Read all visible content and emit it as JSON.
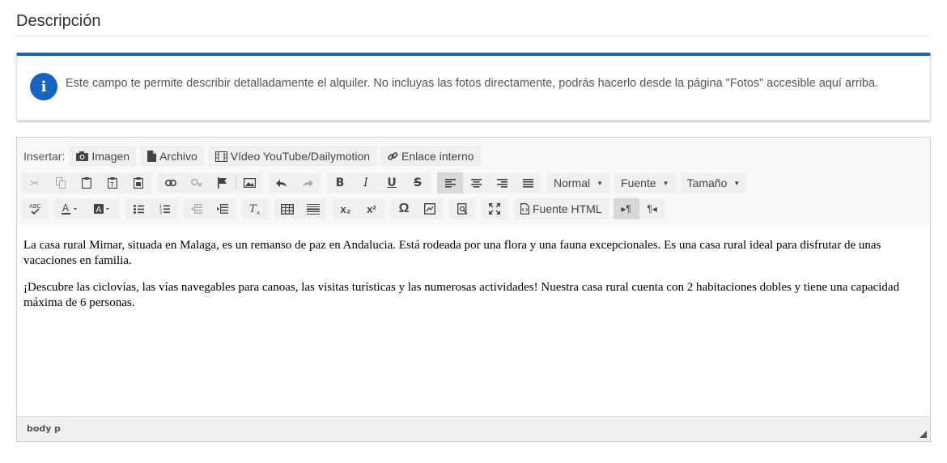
{
  "section": {
    "title": "Descripción"
  },
  "info": {
    "icon": "info-icon",
    "text": "Este campo te permite describir detalladamente el alquiler. No incluyas las fotos directamente, podrás hacerlo desde la página \"Fotos\" accesible aquí arriba.",
    "accent": "#1565c0"
  },
  "toolbar": {
    "insert_label": "Insertar:",
    "insert_buttons": [
      {
        "label": "Imagen",
        "icon": "camera-icon"
      },
      {
        "label": "Archivo",
        "icon": "file-icon"
      },
      {
        "label": "Vídeo YouTube/Dailymotion",
        "icon": "film-icon"
      },
      {
        "label": "Enlace interno",
        "icon": "link-icon"
      }
    ],
    "format_label": "Normal",
    "font_label": "Fuente",
    "size_label": "Tamaño",
    "source_label": "Fuente HTML",
    "bold": "B",
    "italic": "I",
    "underline": "U",
    "strike": "S",
    "subscript": "x₂",
    "superscript": "x²",
    "omega": "Ω",
    "ltr": "▸¶",
    "rtl": "¶◂"
  },
  "content": {
    "paragraphs": [
      "La casa rural Mimar, situada en Malaga, es un remanso de paz en Andalucia. Está rodeada por una flora y una fauna excepcionales. Es una casa rural ideal para disfrutar de unas vacaciones en familia.",
      "¡Descubre las ciclovías, las vías navegables para canoas, las visitas turísticas y las numerosas actividades! Nuestra casa rural cuenta con 2 habitaciones dobles y tiene una capacidad máxima de 6 personas."
    ]
  },
  "statusbar": {
    "path": [
      "body",
      "p"
    ]
  }
}
